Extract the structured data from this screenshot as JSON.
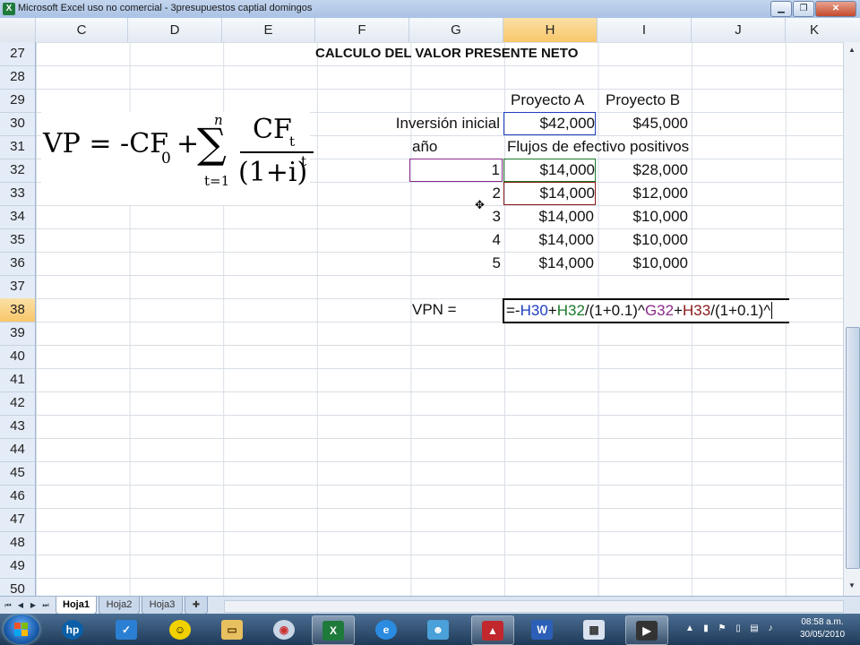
{
  "window": {
    "title": "Microsoft Excel uso no comercial - 3presupuestos captial domingos",
    "min_icon": "minimize-icon",
    "max_icon": "restore-icon",
    "close_icon": "close-icon"
  },
  "columns": [
    "C",
    "D",
    "E",
    "F",
    "G",
    "H",
    "I",
    "J",
    "K"
  ],
  "rows": [
    "27",
    "28",
    "29",
    "30",
    "31",
    "32",
    "33",
    "34",
    "35",
    "36",
    "37",
    "38",
    "39",
    "40",
    "41",
    "42",
    "43",
    "44",
    "45",
    "46",
    "47",
    "48",
    "49",
    "50"
  ],
  "sheet": {
    "title": "CALCULO DEL VALOR PRESENTE NETO",
    "proyecto_a": "Proyecto A",
    "proyecto_b": "Proyecto B",
    "inversion_label": "Inversión inicial",
    "inversion_a": "$42,000",
    "inversion_b": "$45,000",
    "anio_label": "año",
    "flujos_label": "Flujos de efectivo positivos",
    "flows": [
      {
        "year": "1",
        "a": "$14,000",
        "b": "$28,000"
      },
      {
        "year": "2",
        "a": "$14,000",
        "b": "$12,000"
      },
      {
        "year": "3",
        "a": "$14,000",
        "b": "$10,000"
      },
      {
        "year": "4",
        "a": "$14,000",
        "b": "$10,000"
      },
      {
        "year": "5",
        "a": "$14,000",
        "b": "$10,000"
      }
    ],
    "vpn_label": "VPN =",
    "formula": {
      "p1": "=-",
      "ref1": "H30",
      "p2": "+",
      "ref2": "H32",
      "p3": "/(1+0.1)^",
      "ref3": "G32",
      "p4": "+",
      "ref4": "H33",
      "p5": "/(1+0.1)^"
    },
    "ref_colors": {
      "H30": "#1f3fbf",
      "H32": "#1a7a2a",
      "G32": "#8a2a8a",
      "H33": "#8a1a1a"
    }
  },
  "equation": {
    "lhs": "VP = -CF",
    "lhs_sub": "0",
    "plus": "+",
    "sum_top": "n",
    "sum_bottom": "t=1",
    "num": "CF",
    "num_sub": "t",
    "den": "(1+i)",
    "den_sup": "t"
  },
  "tabs": [
    "Hoja1",
    "Hoja2",
    "Hoja3"
  ],
  "taskbar": {
    "time": "08:58 a.m.",
    "date": "30/05/2010",
    "apps": [
      "hp-icon",
      "checkmark-app-icon",
      "messenger-icon",
      "folder-icon",
      "media-player-icon",
      "excel-icon",
      "internet-explorer-icon",
      "people-icon",
      "acrobat-icon",
      "word-icon",
      "calculator-icon",
      "video-icon"
    ]
  }
}
